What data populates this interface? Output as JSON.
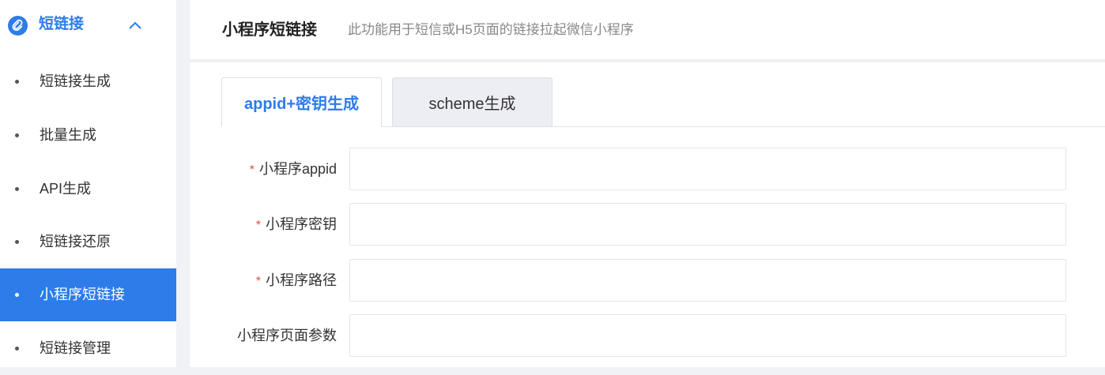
{
  "sidebar": {
    "group_title": "短链接",
    "group_icon": "link-icon",
    "expand_icon": "chevron-up-icon",
    "items": [
      {
        "label": "短链接生成",
        "active": false
      },
      {
        "label": "批量生成",
        "active": false
      },
      {
        "label": "API生成",
        "active": false
      },
      {
        "label": "短链接还原",
        "active": false
      },
      {
        "label": "小程序短链接",
        "active": true
      },
      {
        "label": "短链接管理",
        "active": false
      }
    ]
  },
  "header": {
    "title": "小程序短链接",
    "description": "此功能用于短信或H5页面的链接拉起微信小程序"
  },
  "tabs": [
    {
      "label": "appid+密钥生成",
      "active": true
    },
    {
      "label": "scheme生成",
      "active": false
    }
  ],
  "form": {
    "required_mark": "*",
    "fields": [
      {
        "label": "小程序appid",
        "required": true,
        "value": "",
        "placeholder": ""
      },
      {
        "label": "小程序密钥",
        "required": true,
        "value": "",
        "placeholder": ""
      },
      {
        "label": "小程序路径",
        "required": true,
        "value": "",
        "placeholder": ""
      },
      {
        "label": "小程序页面参数",
        "required": false,
        "value": "",
        "placeholder": ""
      }
    ]
  },
  "colors": {
    "accent": "#2d7ce9",
    "required": "#e74c3c",
    "inactive_tab_bg": "#ededf4"
  }
}
